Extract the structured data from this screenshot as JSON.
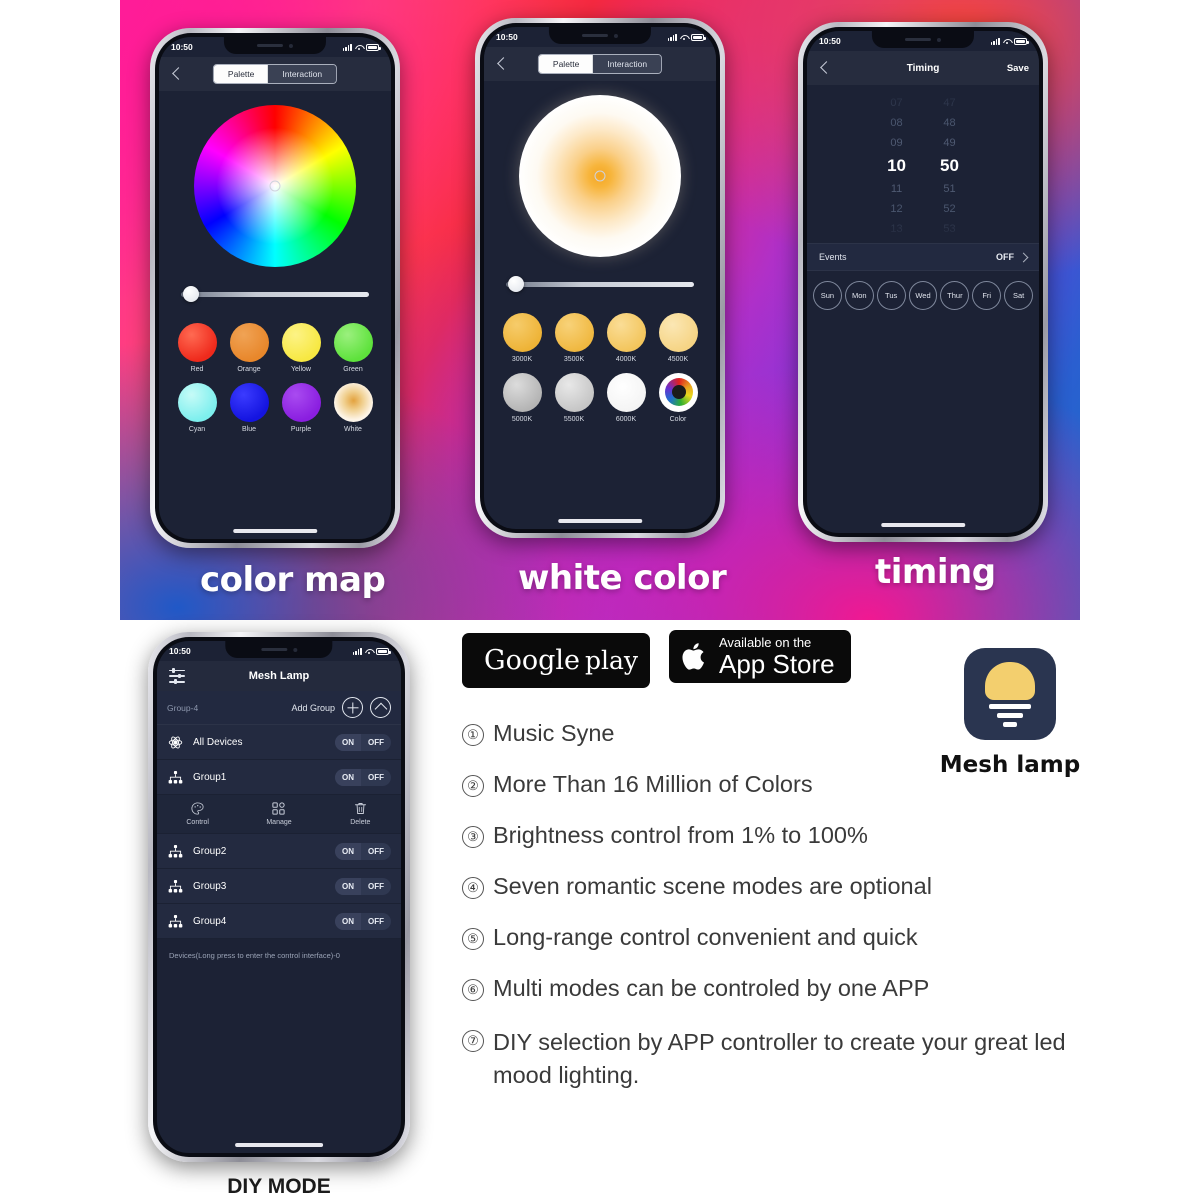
{
  "captions": {
    "color_map": "color map",
    "white_color": "white color",
    "timing": "timing",
    "diy_mode": "DIY MODE"
  },
  "status_bar": {
    "time": "10:50"
  },
  "phone_palette": {
    "tabs": [
      {
        "label": "Palette",
        "active": true
      },
      {
        "label": "Interaction",
        "active": false
      }
    ],
    "swatches": [
      {
        "label": "Red",
        "color": "#ef2a1c"
      },
      {
        "label": "Orange",
        "color": "#e8872b"
      },
      {
        "label": "Yellow",
        "color": "#f7e842"
      },
      {
        "label": "Green",
        "color": "#5ee23c"
      },
      {
        "label": "Cyan",
        "color": "#7defee"
      },
      {
        "label": "Blue",
        "color": "#1414e0"
      },
      {
        "label": "Purple",
        "color": "#8a1ee0"
      },
      {
        "label": "White",
        "color": "#ffffff"
      }
    ]
  },
  "phone_white": {
    "tabs": [
      {
        "label": "Palette",
        "active": true
      },
      {
        "label": "Interaction",
        "active": false
      }
    ],
    "swatches": [
      {
        "label": "3000K",
        "color": "#f0b83f"
      },
      {
        "label": "3500K",
        "color": "#f2bc48"
      },
      {
        "label": "4000K",
        "color": "#f4c85e"
      },
      {
        "label": "4500K",
        "color": "#f6d484"
      },
      {
        "label": "5000K",
        "color": "#bcbcbc"
      },
      {
        "label": "5500K",
        "color": "#cdcdcd"
      },
      {
        "label": "6000K",
        "color": "#fbfbfb"
      },
      {
        "label": "Color",
        "color": "#ffffff"
      }
    ]
  },
  "phone_timing": {
    "nav": {
      "title": "Timing",
      "save": "Save"
    },
    "picker": {
      "hours": [
        "07",
        "08",
        "09",
        "10",
        "11",
        "12",
        "13"
      ],
      "minutes": [
        "47",
        "48",
        "49",
        "50",
        "51",
        "52",
        "53"
      ],
      "selected_hour": "10",
      "selected_minute": "50"
    },
    "events": {
      "label": "Events",
      "value": "OFF"
    },
    "days": [
      "Sun",
      "Mon",
      "Tus",
      "Wed",
      "Thur",
      "Fri",
      "Sat"
    ]
  },
  "phone_diy": {
    "title": "Mesh Lamp",
    "group_header": {
      "group_label": "Group-4",
      "add_group": "Add Group"
    },
    "rows": [
      {
        "name": "All Devices",
        "on": "ON",
        "off": "OFF",
        "icon": "atom-icon"
      },
      {
        "name": "Group1",
        "on": "ON",
        "off": "OFF",
        "icon": "group-icon"
      },
      {
        "name": "Group2",
        "on": "ON",
        "off": "OFF",
        "icon": "group-icon"
      },
      {
        "name": "Group3",
        "on": "ON",
        "off": "OFF",
        "icon": "group-icon"
      },
      {
        "name": "Group4",
        "on": "ON",
        "off": "OFF",
        "icon": "group-icon"
      }
    ],
    "actions": [
      {
        "label": "Control",
        "icon": "palette-icon"
      },
      {
        "label": "Manage",
        "icon": "grid-icon"
      },
      {
        "label": "Delete",
        "icon": "trash-icon"
      }
    ],
    "devices_note": "Devices(Long press to enter the control interface)-0"
  },
  "stores": {
    "google_play": {
      "line1": "Google",
      "line2": "play"
    },
    "app_store": {
      "line1": "Available on the",
      "line2": "App Store"
    }
  },
  "app": {
    "icon_label": "Mesh lamp"
  },
  "features": [
    {
      "num": "①",
      "text": "Music Syne"
    },
    {
      "num": "②",
      "text": "More Than 16 Million of Colors"
    },
    {
      "num": "③",
      "text": "Brightness control from 1% to 100%"
    },
    {
      "num": "④",
      "text": "Seven romantic scene modes are optional"
    },
    {
      "num": "⑤",
      "text": "Long-range control convenient and quick"
    },
    {
      "num": "⑥",
      "text": "Multi modes can be controled by one APP"
    },
    {
      "num": "⑦",
      "text": "DIY selection by APP controller to create your great led mood lighting."
    }
  ],
  "colors": {
    "screen_bg": "#1c2235",
    "nav_bg": "#262c3e",
    "accent_yellow": "#f3cf6e",
    "app_icon_bg": "#2a3550"
  }
}
